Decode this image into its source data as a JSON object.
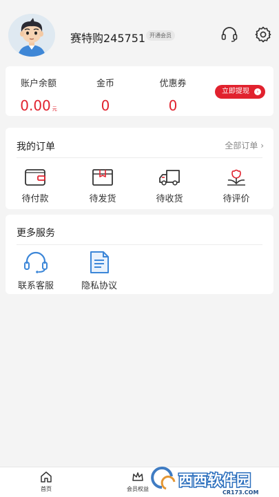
{
  "profile": {
    "username": "赛特购245751",
    "member_badge": "开通会员"
  },
  "account": {
    "balance_label": "账户余额",
    "balance_value": "0.00",
    "balance_unit": "元",
    "coins_label": "金币",
    "coins_value": "0",
    "coupons_label": "优惠券",
    "coupons_value": "0",
    "withdraw_label": "立即提现"
  },
  "orders": {
    "title": "我的订单",
    "all_label": "全部订单 ›",
    "items": [
      {
        "label": "待付款",
        "icon": "wallet-icon"
      },
      {
        "label": "待发货",
        "icon": "package-icon"
      },
      {
        "label": "待收货",
        "icon": "truck-icon"
      },
      {
        "label": "待评价",
        "icon": "flower-icon"
      }
    ]
  },
  "services": {
    "title": "更多服务",
    "items": [
      {
        "label": "联系客服",
        "icon": "headset-icon"
      },
      {
        "label": "隐私协议",
        "icon": "document-icon"
      }
    ]
  },
  "tabbar": {
    "items": [
      {
        "label": "首页",
        "icon": "home-icon"
      },
      {
        "label": "会员权益",
        "icon": "crown-icon"
      }
    ]
  },
  "watermark": {
    "text": "西西软件园",
    "subtext": "CR173.COM"
  },
  "colors": {
    "accent": "#e1222e",
    "background": "#f4f4f4",
    "card": "#ffffff",
    "service_icon": "#3b86d8"
  }
}
